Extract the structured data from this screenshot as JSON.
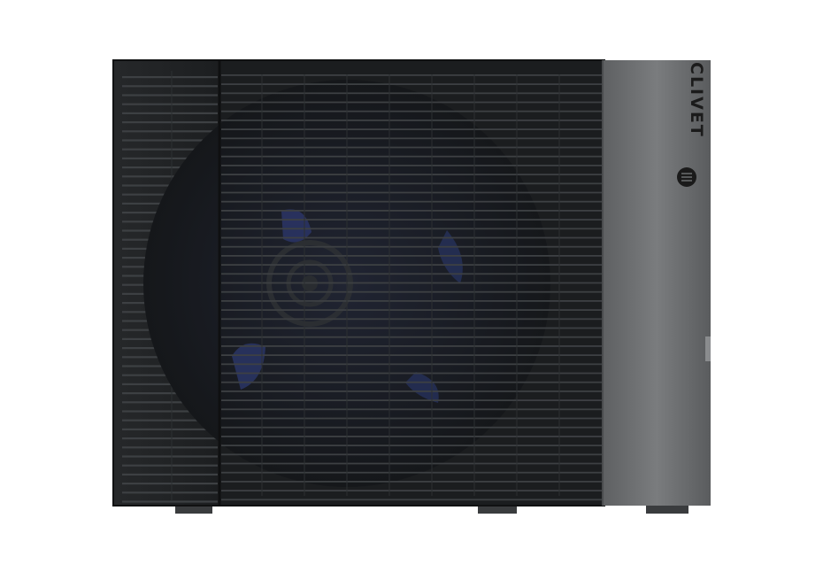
{
  "product": {
    "brand": "CLIVET"
  },
  "colors": {
    "grille_dark": "#1a1c1e",
    "grille_slat": "#3d4043",
    "side_panel": "#6a6c6e",
    "fan_blade_tint": "#2a3560",
    "background": "#ffffff"
  },
  "icons": {
    "logo": "clivet-logo-icon"
  }
}
